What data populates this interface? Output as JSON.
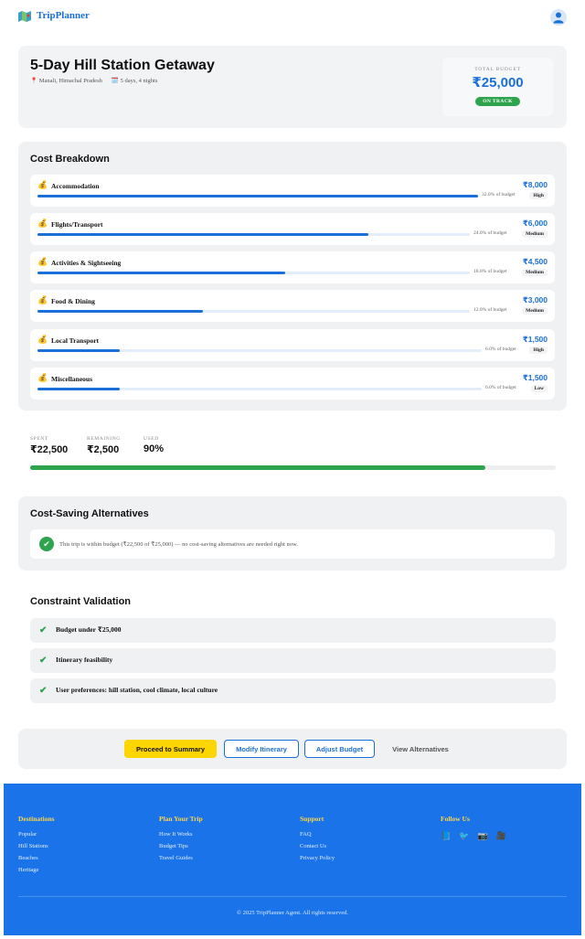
{
  "header": {
    "brand": "TripPlanner",
    "brand_icon": "map-icon",
    "avatar_icon": "user-icon"
  },
  "trip": {
    "title": "5-Day Hill Station Getaway",
    "location": "Manali, Himachal Pradesh",
    "duration": "5 days, 4 nights",
    "budget_label": "TOTAL BUDGET",
    "budget_value": "₹25,000",
    "status": "ON TRACK"
  },
  "cost_breakdown": {
    "title": "Cost Breakdown",
    "items": [
      {
        "name": "Accommodation",
        "amount": "₹8,000",
        "pct_text": "32.0% of budget",
        "pct": 32.0,
        "level": "High"
      },
      {
        "name": "Flights/Transport",
        "amount": "₹6,000",
        "pct_text": "24.0% of budget",
        "pct": 24.0,
        "level": "Medium"
      },
      {
        "name": "Activities & Sightseeing",
        "amount": "₹4,500",
        "pct_text": "18.0% of budget",
        "pct": 18.0,
        "level": "Medium"
      },
      {
        "name": "Food & Dining",
        "amount": "₹3,000",
        "pct_text": "12.0% of budget",
        "pct": 12.0,
        "level": "Medium"
      },
      {
        "name": "Local Transport",
        "amount": "₹1,500",
        "pct_text": "6.0% of budget",
        "pct": 6.0,
        "level": "High"
      },
      {
        "name": "Miscellaneous",
        "amount": "₹1,500",
        "pct_text": "6.0% of budget",
        "pct": 6.0,
        "level": "Low"
      }
    ]
  },
  "summary": {
    "spent_label": "SPENT",
    "spent": "₹22,500",
    "remaining_label": "REMAINING",
    "remaining": "₹2,500",
    "used_label": "USED",
    "used": "90%",
    "used_fraction": 0.9
  },
  "alternatives": {
    "title": "Cost-Saving Alternatives",
    "message": "This trip is within budget (₹22,500 of ₹25,000) — no cost-saving alternatives are needed right now."
  },
  "constraints": {
    "title": "Constraint Validation",
    "items": [
      "Budget under ₹25,000",
      "Itinerary feasibility",
      "User preferences: hill station, cool climate, local culture"
    ]
  },
  "actions": {
    "proceed": "Proceed to Summary",
    "modify": "Modify Itinerary",
    "adjust": "Adjust Budget",
    "alternatives": "View Alternatives"
  },
  "footer": {
    "columns": [
      {
        "heading": "Destinations",
        "links": [
          "Popular",
          "Hill Stations",
          "Beaches",
          "Heritage"
        ]
      },
      {
        "heading": "Plan Your Trip",
        "links": [
          "How It Works",
          "Budget Tips",
          "Travel Guides"
        ]
      },
      {
        "heading": "Support",
        "links": [
          "FAQ",
          "Contact Us",
          "Privacy Policy"
        ]
      }
    ],
    "follow_heading": "Follow Us",
    "social": [
      "📘",
      "🐦",
      "📷",
      "🎥"
    ],
    "copyright": "© 2025 TripPlanner Agent. All rights reserved."
  },
  "colors": {
    "accent": "#1a6fd8",
    "success": "#2ea44f",
    "primary_button": "#fdd500",
    "footer": "#1a73e8"
  }
}
